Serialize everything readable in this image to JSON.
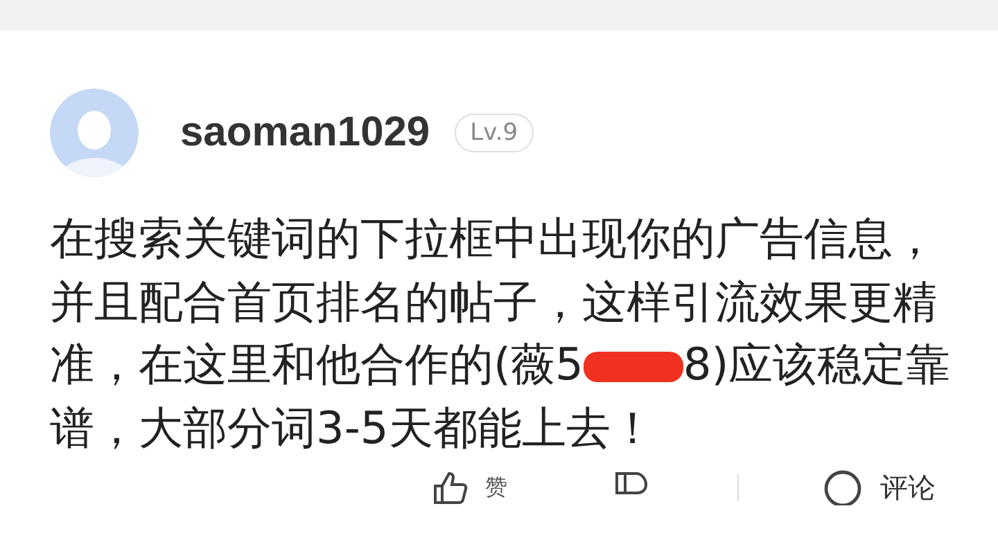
{
  "comment": {
    "username": "saoman1029",
    "level_badge": "Lv.9",
    "body_before": "在搜索关键词的下拉框中出现你的广告信息，并且配合首页排名的帖子，这样引流效果更精准，在这里和他合作的(薇5",
    "body_after": "8)应该稳定靠谱，大部分词3-5天都能上去！"
  },
  "actions": [
    {
      "kind": "like",
      "label": "赞"
    },
    {
      "kind": "dislike"
    },
    {
      "kind": "comment",
      "label": "评论"
    }
  ]
}
